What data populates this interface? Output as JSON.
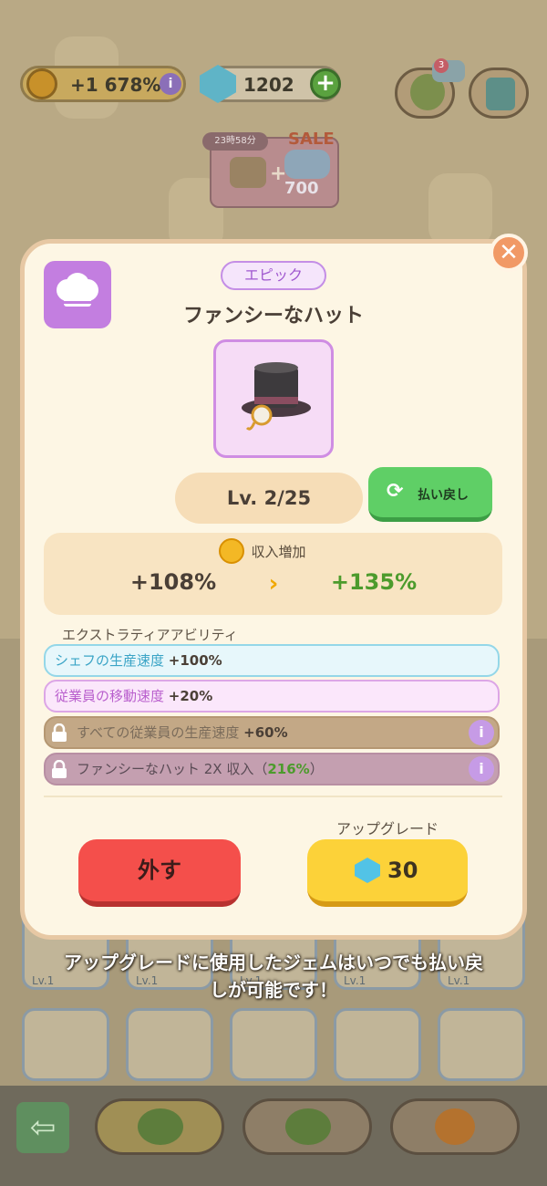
{
  "hud": {
    "income_bonus": "+1 678%",
    "gems": "1202",
    "plus_icon": "+",
    "info_icon": "i",
    "notification_count": "3"
  },
  "sale": {
    "timer": "23時58分",
    "label": "SALE",
    "gem_amount": "700"
  },
  "modal": {
    "rarity": "エピック",
    "item_name": "ファンシーなハット",
    "level": "Lv. 2/25",
    "refund_label": "払い戻し",
    "income_label": "収入増加",
    "income_from": "+108%",
    "income_to": "+135%",
    "extra_title": "エクストラティアアビリティ",
    "abilities": [
      {
        "text": "シェフの生産速度",
        "value": "+100%"
      },
      {
        "text": "従業員の移動速度",
        "value": "+20%"
      },
      {
        "text": "すべての従業員の生産速度",
        "value": "+60%"
      },
      {
        "text": "ファンシーなハット 2X 収入（",
        "value": "216%",
        "suffix": "）"
      }
    ],
    "upgrade_label": "アップグレード",
    "remove_label": "外す",
    "upgrade_cost": "30",
    "close_icon": "✕"
  },
  "footer_message_line1": "アップグレードに使用したジェムはいつでも払い戻",
  "footer_message_line2": "しが可能です！",
  "background_cards": [
    "Lv.1",
    "Lv.1",
    "Lv.1",
    "Lv.1",
    "Lv.1"
  ],
  "colors": {
    "accent_green": "#4c9b2c",
    "remove_red": "#f44f4b",
    "upgrade_yellow": "#fcd239",
    "epic_purple": "#c37ee0"
  }
}
